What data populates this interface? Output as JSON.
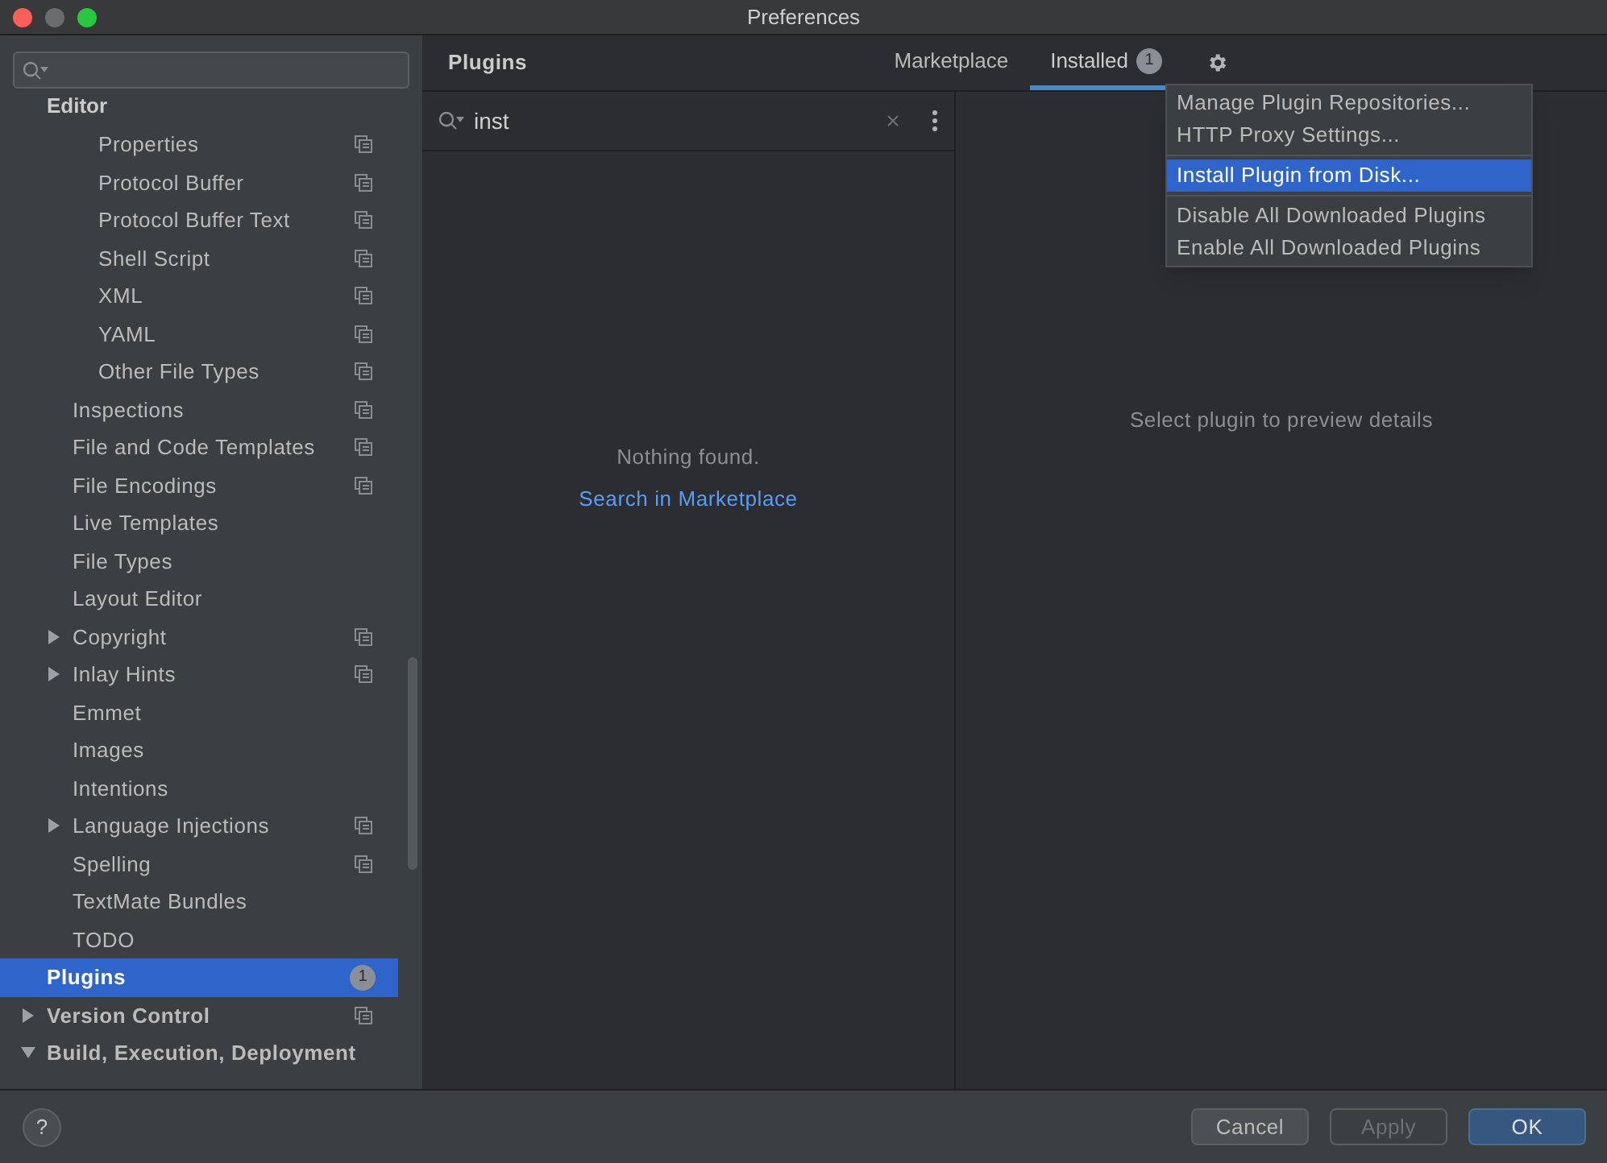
{
  "window": {
    "title": "Preferences"
  },
  "sidebar": {
    "tree": [
      {
        "label": "Editor",
        "selected": false,
        "children": [
          {
            "children": [
              {
                "label": "Properties",
                "scoped": true,
                "selected": false
              },
              {
                "label": "Protocol Buffer",
                "scoped": true,
                "selected": false
              },
              {
                "label": "Protocol Buffer Text",
                "scoped": true,
                "selected": false
              },
              {
                "label": "Shell Script",
                "scoped": true,
                "selected": false
              },
              {
                "label": "XML",
                "scoped": true,
                "selected": false
              },
              {
                "label": "YAML",
                "scoped": true,
                "selected": false
              },
              {
                "label": "Other File Types",
                "scoped": true,
                "selected": false
              }
            ]
          },
          {
            "label": "Inspections",
            "scoped": true,
            "selected": false
          },
          {
            "label": "File and Code Templates",
            "scoped": true,
            "selected": false
          },
          {
            "label": "File Encodings",
            "scoped": true,
            "selected": false
          },
          {
            "label": "Live Templates",
            "scoped": false,
            "selected": false
          },
          {
            "label": "File Types",
            "scoped": false,
            "selected": false
          },
          {
            "label": "Layout Editor",
            "scoped": false,
            "selected": false
          },
          {
            "label": "Copyright",
            "scoped": true,
            "expanded": false,
            "selected": false
          },
          {
            "label": "Inlay Hints",
            "scoped": true,
            "expanded": false,
            "selected": false
          },
          {
            "label": "Emmet",
            "scoped": false,
            "selected": false
          },
          {
            "label": "Images",
            "scoped": false,
            "selected": false
          },
          {
            "label": "Intentions",
            "scoped": false,
            "selected": false
          },
          {
            "label": "Language Injections",
            "scoped": true,
            "expanded": false,
            "selected": false
          },
          {
            "label": "Spelling",
            "scoped": true,
            "selected": false
          },
          {
            "label": "TextMate Bundles",
            "scoped": false,
            "selected": false
          },
          {
            "label": "TODO",
            "scoped": false,
            "selected": false
          }
        ]
      },
      {
        "label": "Plugins",
        "badge": "1",
        "scoped": false,
        "selected": true
      },
      {
        "label": "Version Control",
        "scoped": true,
        "expanded": false,
        "selected": false
      },
      {
        "label": "Build, Execution, Deployment",
        "scoped": false,
        "expanded": true,
        "selected": false
      }
    ]
  },
  "header": {
    "title": "Plugins",
    "tabs": [
      {
        "label": "Marketplace",
        "selected": false
      },
      {
        "label": "Installed",
        "badge": "1",
        "selected": true
      }
    ]
  },
  "plugin_search": {
    "value": "inst"
  },
  "list_pane": {
    "message": "Nothing found.",
    "link": "Search in Marketplace"
  },
  "details_pane": {
    "message": "Select plugin to preview details"
  },
  "menu": {
    "groups": [
      [
        {
          "label": "Manage Plugin Repositories...",
          "selected": false
        },
        {
          "label": "HTTP Proxy Settings...",
          "selected": false
        }
      ],
      [
        {
          "label": "Install Plugin from Disk...",
          "selected": true
        }
      ],
      [
        {
          "label": "Disable All Downloaded Plugins",
          "selected": false
        },
        {
          "label": "Enable All Downloaded Plugins",
          "selected": false
        }
      ]
    ]
  },
  "footer": {
    "help": "?",
    "buttons": [
      {
        "label": "Cancel",
        "kind": "normal",
        "disabled": false
      },
      {
        "label": "Apply",
        "kind": "normal",
        "disabled": true
      },
      {
        "label": "OK",
        "kind": "default",
        "disabled": false
      }
    ]
  }
}
